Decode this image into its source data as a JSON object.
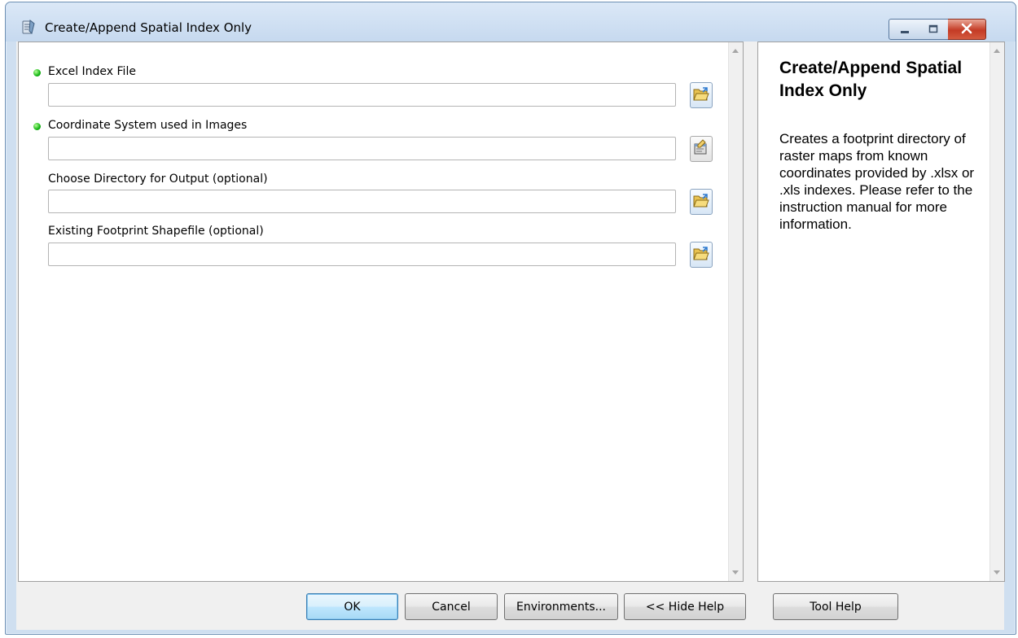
{
  "window": {
    "title": "Create/Append Spatial Index Only",
    "icon": "toolbox-script-icon"
  },
  "params": [
    {
      "label": "Excel Index File",
      "required": true,
      "value": "",
      "browse_icon": "folder-browse-icon"
    },
    {
      "label": "Coordinate System used in Images",
      "required": true,
      "value": "",
      "browse_icon": "spatial-reference-properties-icon"
    },
    {
      "label": "Choose Directory for Output (optional)",
      "required": false,
      "value": "",
      "browse_icon": "folder-browse-icon"
    },
    {
      "label": "Existing Footprint Shapefile (optional)",
      "required": false,
      "value": "",
      "browse_icon": "folder-browse-icon"
    }
  ],
  "help": {
    "title": "Create/Append Spatial Index Only",
    "body": "Creates a footprint directory of raster maps from known coordinates provided by .xlsx or .xls indexes. Please refer to the instruction manual for more information."
  },
  "buttons": {
    "ok": "OK",
    "cancel": "Cancel",
    "environments": "Environments...",
    "hide_help": "<< Hide Help",
    "tool_help": "Tool Help"
  },
  "colors": {
    "required_dot": "#12b512",
    "close_button": "#c43b25",
    "default_button_border": "#3c7fb1"
  }
}
